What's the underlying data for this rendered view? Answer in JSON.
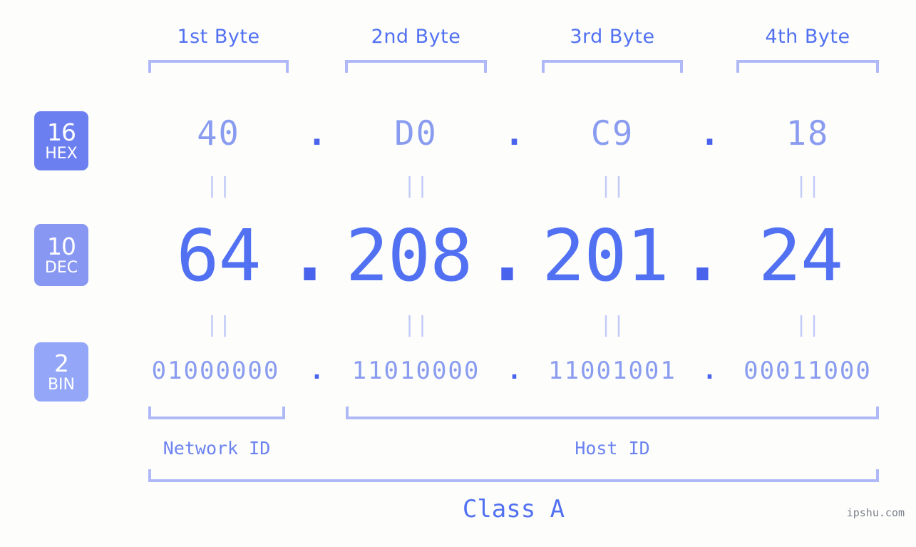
{
  "background_color": "#fdfefb",
  "accent_colors": {
    "primary": "#5271f2",
    "light": "#8a9cf0",
    "bracket": "#b0b9f7",
    "equals": "#c3cbf8",
    "dot": "#4a63ec"
  },
  "byte_headers": [
    {
      "label": "1st Byte"
    },
    {
      "label": "2nd Byte"
    },
    {
      "label": "3rd Byte"
    },
    {
      "label": "4th Byte"
    }
  ],
  "bases": [
    {
      "num": "16",
      "name": "HEX",
      "color": "#6c7ff0"
    },
    {
      "num": "10",
      "name": "DEC",
      "color": "#8897f2"
    },
    {
      "num": "2",
      "name": "BIN",
      "color": "#93a6f7"
    }
  ],
  "separator": ".",
  "equals_glyph": "||",
  "rows": {
    "hex": {
      "base_label": "HEX",
      "values": [
        "40",
        "D0",
        "C9",
        "18"
      ]
    },
    "dec": {
      "base_label": "DEC",
      "values": [
        "64",
        "208",
        "201",
        "24"
      ]
    },
    "bin": {
      "base_label": "BIN",
      "values": [
        "01000000",
        "11010000",
        "11001001",
        "00011000"
      ]
    }
  },
  "segments": {
    "network_id": "Network ID",
    "host_id": "Host ID"
  },
  "class_label": "Class A",
  "watermark": "ipshu.com"
}
